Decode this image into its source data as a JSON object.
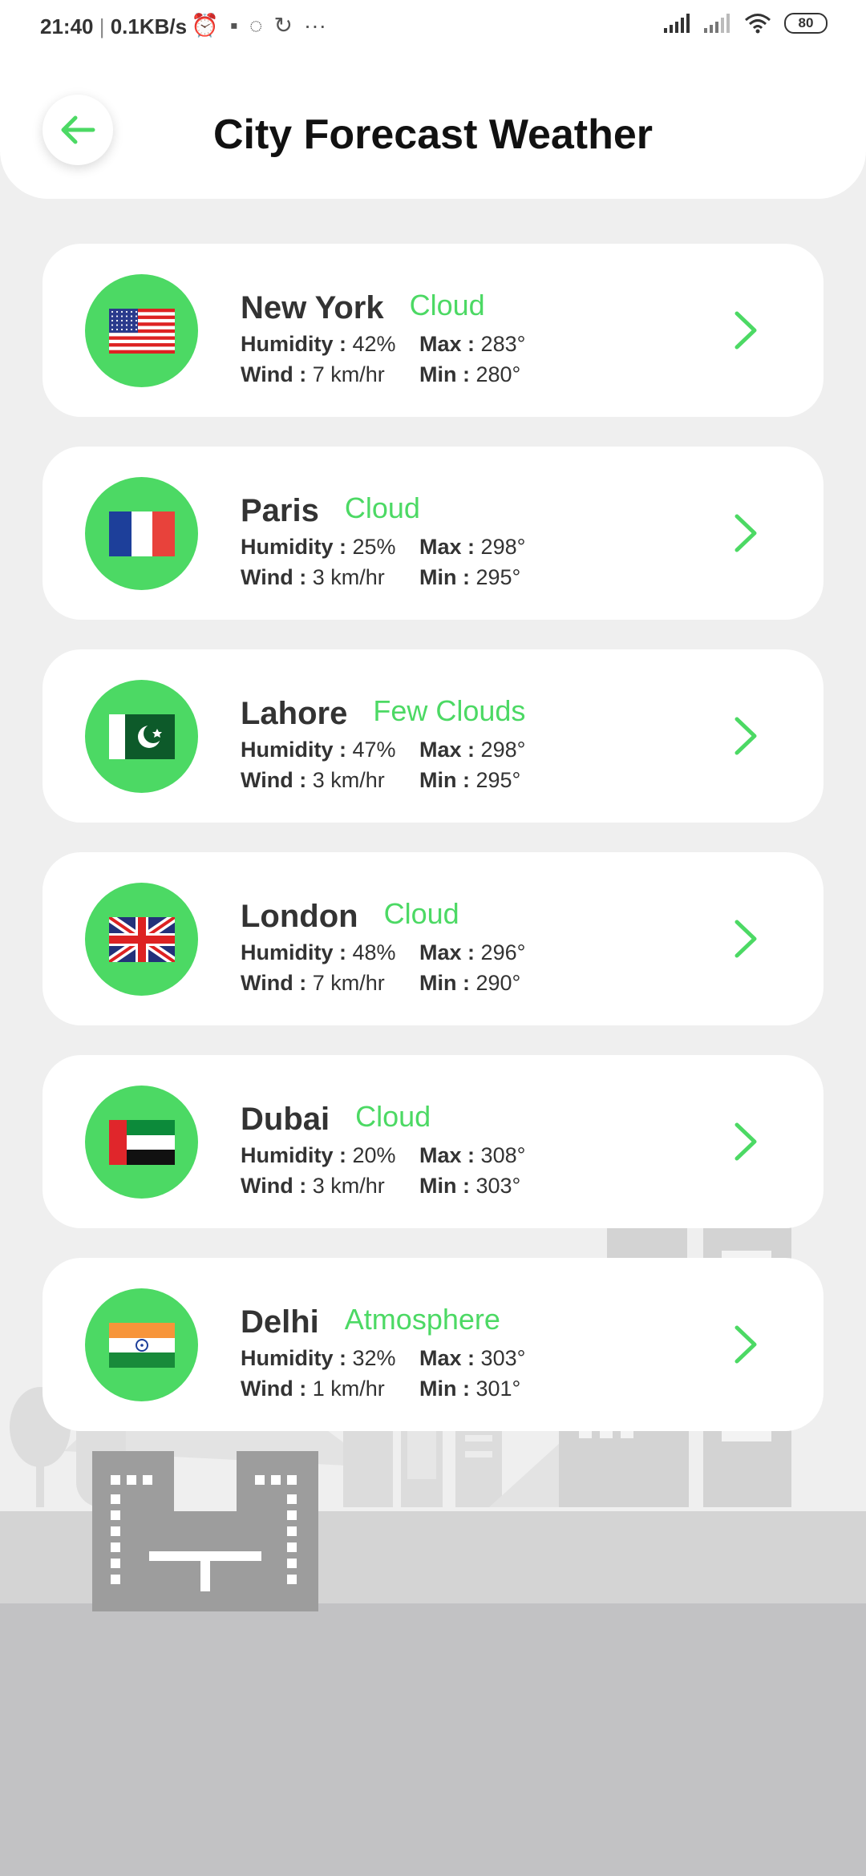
{
  "status_bar": {
    "time": "21:40",
    "speed": "0.1KB/s",
    "battery": "80",
    "more": "···"
  },
  "header": {
    "title": "City Forecast Weather"
  },
  "labels": {
    "humidity": "Humidity :",
    "wind": "Wind :",
    "max": "Max :",
    "min": "Min :"
  },
  "colors": {
    "accent": "#4cd964",
    "card": "#ffffff",
    "background": "#efefef"
  },
  "cities": [
    {
      "name": "New York",
      "condition": "Cloud",
      "humidity": "42%",
      "wind": "7 km/hr",
      "max": "283°",
      "min": "280°",
      "flag": "usa-flag-icon"
    },
    {
      "name": "Paris",
      "condition": "Cloud",
      "humidity": "25%",
      "wind": "3 km/hr",
      "max": "298°",
      "min": "295°",
      "flag": "france-flag-icon"
    },
    {
      "name": "Lahore",
      "condition": "Few Clouds",
      "humidity": "47%",
      "wind": "3 km/hr",
      "max": "298°",
      "min": "295°",
      "flag": "pakistan-flag-icon"
    },
    {
      "name": "London",
      "condition": "Cloud",
      "humidity": "48%",
      "wind": "7 km/hr",
      "max": "296°",
      "min": "290°",
      "flag": "uk-flag-icon"
    },
    {
      "name": "Dubai",
      "condition": "Cloud",
      "humidity": "20%",
      "wind": "3 km/hr",
      "max": "308°",
      "min": "303°",
      "flag": "uae-flag-icon"
    },
    {
      "name": "Delhi",
      "condition": "Atmosphere",
      "humidity": "32%",
      "wind": "1 km/hr",
      "max": "303°",
      "min": "301°",
      "flag": "india-flag-icon"
    }
  ]
}
